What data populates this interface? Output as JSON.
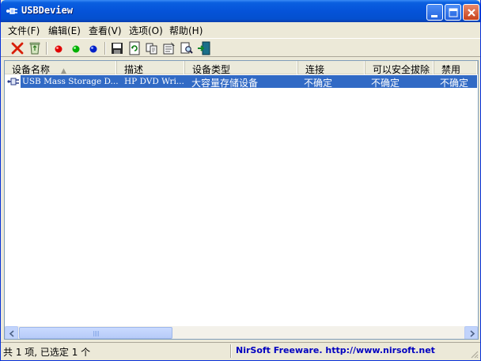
{
  "window": {
    "title": "USBDeview",
    "icon": "usb-plug-icon",
    "controls": [
      "minimize-icon",
      "maximize-icon",
      "close-icon"
    ]
  },
  "menu": {
    "items": [
      {
        "label": "文件(F)"
      },
      {
        "label": "编辑(E)"
      },
      {
        "label": "查看(V)"
      },
      {
        "label": "选项(O)"
      },
      {
        "label": "帮助(H)"
      }
    ]
  },
  "toolbar": {
    "buttons": [
      "delete-red-x-icon",
      "recycle-bin-icon",
      "red-dot-disable-icon",
      "green-dot-enable-icon",
      "blue-dot-icon",
      "save-floppy-icon",
      "refresh-icon",
      "copy-icon",
      "properties-icon",
      "find-icon",
      "exit-door-icon"
    ]
  },
  "list": {
    "columns": [
      {
        "label": "设备名称",
        "sort": "▲"
      },
      {
        "label": "描述"
      },
      {
        "label": "设备类型"
      },
      {
        "label": "连接"
      },
      {
        "label": "可以安全拔除"
      },
      {
        "label": "禁用"
      }
    ],
    "rows": [
      {
        "selected": true,
        "device_name": "USB Mass Storage D...",
        "description": "HP DVD Wri...",
        "device_type": "大容量存储设备",
        "connected": "不确定",
        "safe_to_unplug": "不确定",
        "disabled": "不确定"
      }
    ]
  },
  "status": {
    "items_text": "共 1 项, 已选定 1 个",
    "link_text": "NirSoft Freeware.  http://www.nirsoft.net"
  },
  "colors": {
    "titlebar": "#0553d9",
    "selection": "#316ac5",
    "link": "#0000c0"
  }
}
